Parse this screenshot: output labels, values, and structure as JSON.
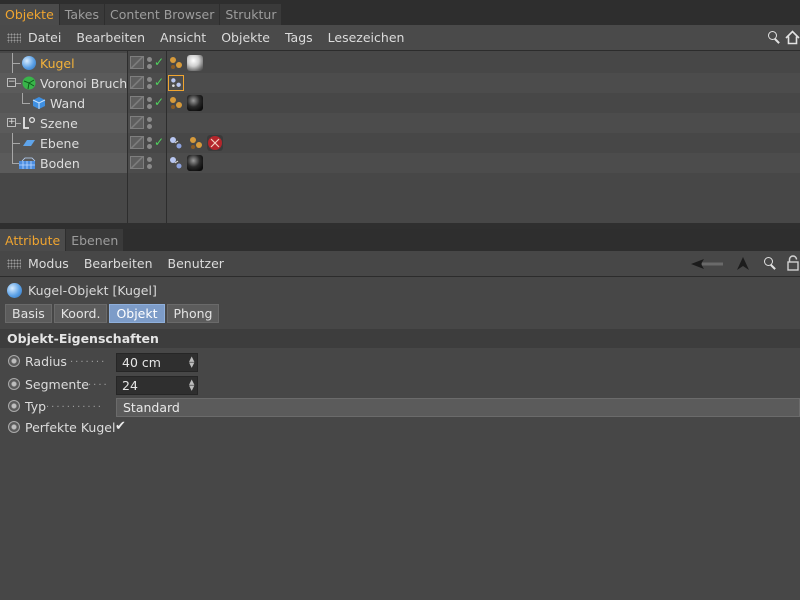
{
  "object_manager": {
    "tabs": [
      "Objekte",
      "Takes",
      "Content Browser",
      "Struktur"
    ],
    "menu": [
      "Datei",
      "Bearbeiten",
      "Ansicht",
      "Objekte",
      "Tags",
      "Lesezeichen"
    ],
    "objects": [
      {
        "name": "Kugel",
        "selected": true,
        "icon": "sphere-icon",
        "check": true
      },
      {
        "name": "Voronoi Bruch",
        "selected": false,
        "icon": "voronoi-fracture-icon",
        "check": true
      },
      {
        "name": "Wand",
        "selected": false,
        "icon": "cube-icon",
        "check": true
      },
      {
        "name": "Szene",
        "selected": false,
        "icon": "null-object-icon",
        "check": false
      },
      {
        "name": "Ebene",
        "selected": false,
        "icon": "plane-icon",
        "check": true
      },
      {
        "name": "Boden",
        "selected": false,
        "icon": "floor-icon",
        "check": false
      }
    ]
  },
  "attribute_manager": {
    "tabs": [
      "Attribute",
      "Ebenen"
    ],
    "menu": [
      "Modus",
      "Bearbeiten",
      "Benutzer"
    ],
    "object_title": "Kugel-Objekt [Kugel]",
    "property_tabs": [
      "Basis",
      "Koord.",
      "Objekt",
      "Phong"
    ],
    "active_property_tab": "Objekt",
    "section_title": "Objekt-Eigenschaften",
    "params": {
      "radius": {
        "label": "Radius",
        "value": "40 cm"
      },
      "segmente": {
        "label": "Segmente",
        "value": "24"
      },
      "typ": {
        "label": "Typ",
        "value": "Standard"
      },
      "perfekte_kugel": {
        "label": "Perfekte Kugel",
        "value": "✔"
      }
    }
  },
  "colors": {
    "accent_orange": "#f0a530",
    "selected_tab_blue": "#7d9cc8",
    "check_green": "#4fd35c"
  }
}
